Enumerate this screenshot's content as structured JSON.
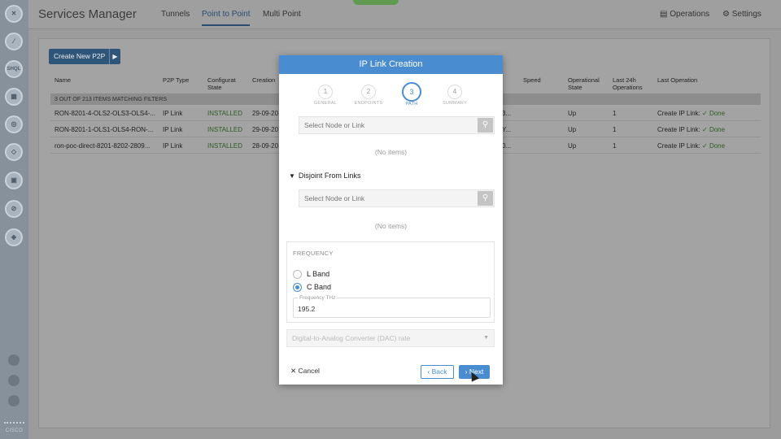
{
  "app": {
    "title": "Services Manager",
    "tabs": [
      "Tunnels",
      "Point to Point",
      "Multi Point"
    ],
    "active_tab": "Point to Point",
    "right_links": [
      "Operations",
      "Settings"
    ]
  },
  "rail": {
    "top_icons": [
      "network-icon",
      "topology-icon",
      "shql-icon",
      "inventory-icon",
      "services-icon",
      "devices-icon",
      "monitor-icon",
      "alarms-icon",
      "config-icon"
    ],
    "shql_text": "SHQL",
    "bottom_icons": [
      "info-icon",
      "settings-icon",
      "user-icon"
    ],
    "brand": "CISCO"
  },
  "toolbar": {
    "create_label": "Create New P2P",
    "create_caret": "▶"
  },
  "table": {
    "headers": [
      "Name",
      "P2P Type",
      "Configurat State",
      "Creation",
      "Speed",
      "Operational State",
      "Last 24h Operations",
      "Last Operation"
    ],
    "filter_text": "3 OUT OF 213 ITEMS MATCHING FILTERS",
    "rows": [
      {
        "name": "RON-8201-4-OLS2-OLS3-OLS4-...",
        "type": "IP Link",
        "config": "INSTALLED",
        "created": "29-09-20",
        "opstate": "Up",
        "ops24": "1",
        "lastop": "Create IP Link:",
        "done": "✓ Done",
        "mid": "3..."
      },
      {
        "name": "RON-8201-1-OLS1-OLS4-RON-...",
        "type": "IP Link",
        "config": "INSTALLED",
        "created": "29-09-20",
        "opstate": "Up",
        "ops24": "1",
        "lastop": "Create IP Link:",
        "done": "✓ Done",
        "mid": "Y..."
      },
      {
        "name": "ron-poc-direct-8201-8202-2809...",
        "type": "IP Link",
        "config": "INSTALLED",
        "created": "28-09-20",
        "opstate": "Up",
        "ops24": "1",
        "lastop": "Create IP Link:",
        "done": "✓ Done",
        "mid": "0..."
      }
    ]
  },
  "modal": {
    "title": "IP Link Creation",
    "steps": [
      {
        "num": "1",
        "label": "GENERAL"
      },
      {
        "num": "2",
        "label": "ENDPOINTS"
      },
      {
        "num": "3",
        "label": "PATH"
      },
      {
        "num": "4",
        "label": "SUMMARY"
      }
    ],
    "active_step": 3,
    "search1_placeholder": "Select Node or Link",
    "no_items_1": "(No items)",
    "disjoint_title": "Disjoint From Links",
    "search2_placeholder": "Select Node or Link",
    "no_items_2": "(No items)",
    "frequency": {
      "section_label": "FREQUENCY",
      "options": [
        "L Band",
        "C Band"
      ],
      "selected": "C Band",
      "field_label": "Frequency THz",
      "field_value": "195.2"
    },
    "dac_placeholder": "Digital-to-Analog Converter (DAC) rate",
    "cancel_label": "Cancel",
    "back_label": "Back",
    "next_label": "Next"
  },
  "colors": {
    "accent": "#4a8cd0",
    "nav_dark": "#2f5578",
    "rail": "#87919b"
  }
}
